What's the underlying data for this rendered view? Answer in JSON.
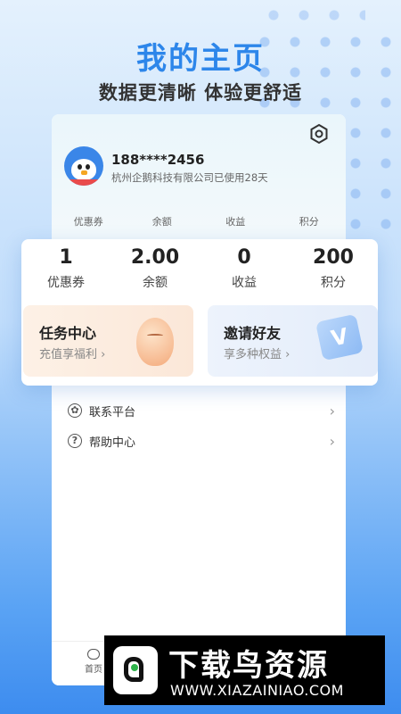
{
  "banner": {
    "headline": "我的主页",
    "subline": "数据更清晰 体验更舒适"
  },
  "profile": {
    "phone": "188****2456",
    "company_line": "杭州企鹅科技有限公司已使用28天"
  },
  "mini_stats": [
    "优惠券",
    "余额",
    "收益",
    "积分"
  ],
  "stats": [
    {
      "value": "1",
      "label": "优惠券"
    },
    {
      "value": "2.00",
      "label": "余额"
    },
    {
      "value": "0",
      "label": "收益"
    },
    {
      "value": "200",
      "label": "积分"
    }
  ],
  "promos": {
    "task": {
      "title": "任务中心",
      "subtitle": "充值享福利 ›"
    },
    "invite": {
      "title": "邀请好友",
      "subtitle": "享多种权益 ›"
    }
  },
  "menu": [
    {
      "label": "联系平台",
      "icon": "leaf-icon"
    },
    {
      "label": "帮助中心",
      "icon": "question-icon"
    }
  ],
  "tabbar": {
    "home": "首页"
  },
  "watermark": {
    "title": "下载鸟资源",
    "url": "WWW.XIAZAINIAO.COM"
  },
  "colors": {
    "accent": "#2d86ea",
    "task_bg": "#fdf1e6",
    "invite_bg": "#edf3fc"
  }
}
